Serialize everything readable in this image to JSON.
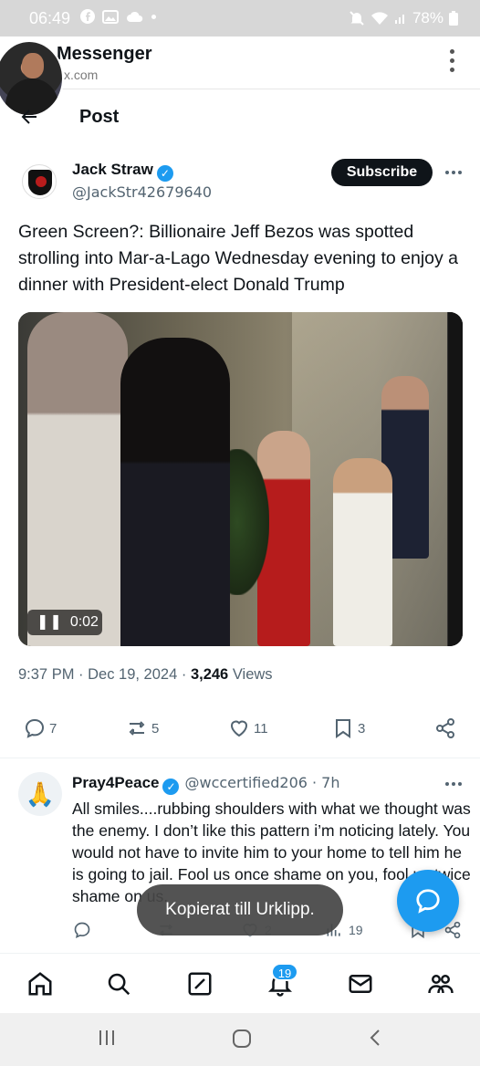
{
  "status_bar": {
    "time": "06:49",
    "battery": "78%"
  },
  "browser": {
    "app_title": "Messenger",
    "url": "x.com"
  },
  "header": {
    "title": "Post"
  },
  "post": {
    "author_name": "Jack Straw",
    "author_handle": "@JackStr42679640",
    "subscribe_label": "Subscribe",
    "text": "Green Screen?: Billionaire Jeff Bezos was spotted strolling into Mar-a-Lago Wednesday evening to enjoy a dinner with President-elect Donald Trump",
    "video_time": "0:02",
    "timestamp": "9:37 PM · Dec 19, 2024 · ",
    "views_count": "3,246",
    "views_label": " Views",
    "replies": "7",
    "reposts": "5",
    "likes": "11",
    "bookmarks": "3"
  },
  "reply": {
    "author_name": "Pray4Peace",
    "avatar_emoji": "🙏",
    "handle_time": "@wccertified206 · 7h",
    "text": "All smiles....rubbing shoulders with what we thought was the enemy. I don’t like this pattern i’m noticing lately. You would not have to invite him to your home to tell him he is going to jail. Fool us once shame on you, fool us twice shame on us.",
    "likes": "2",
    "views": "19"
  },
  "toast": {
    "text": "Kopierat till Urklipp."
  },
  "tabbar": {
    "notifications_badge": "19"
  },
  "colors": {
    "accent": "#1d9bf0",
    "text": "#0f1419",
    "muted": "#536471"
  }
}
